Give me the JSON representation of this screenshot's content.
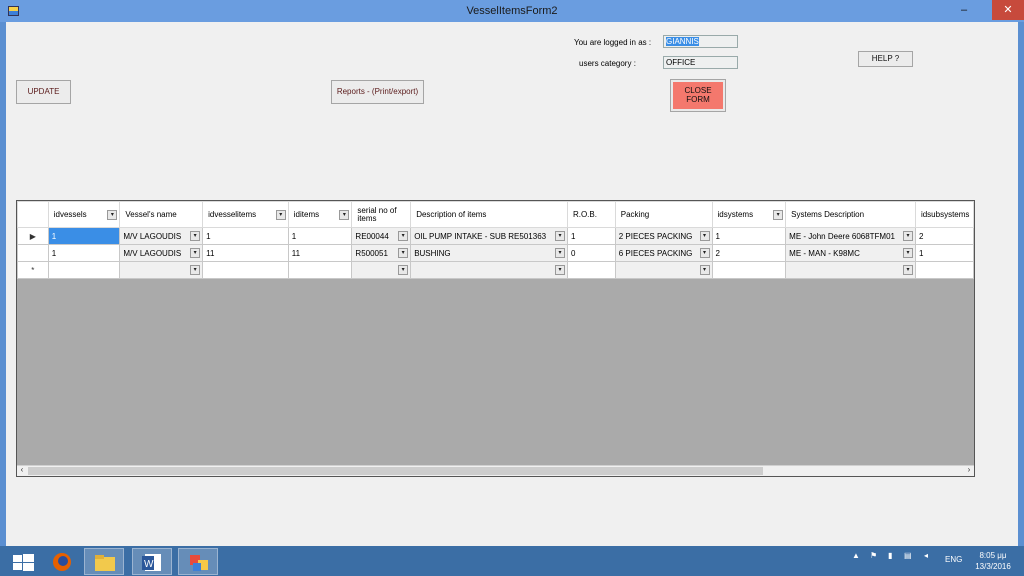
{
  "window": {
    "title": "VesselItemsForm2",
    "min": "–",
    "max": "☐",
    "close": "✕"
  },
  "login": {
    "logged_in_label": "You are logged in as :",
    "user": "GIANNIS",
    "category_label": "users category :",
    "category": "OFFICE"
  },
  "buttons": {
    "update": "UPDATE",
    "reports": "Reports - (Print/export)",
    "close_form_line1": "CLOSE",
    "close_form_line2": "FORM",
    "help": "HELP ?"
  },
  "grid": {
    "columns": [
      "idvessels",
      "Vessel's  name",
      "idvesselitems",
      "iditems",
      "serial no of items",
      "Description of items",
      "R.O.B.",
      "Packing",
      "idsystems",
      "Systems Description",
      "idsubsystems"
    ],
    "rows": [
      [
        "1",
        "M/V LAGOUDIS",
        "1",
        "1",
        "RE00044",
        "OIL PUMP INTAKE - SUB RE501363",
        "1",
        "2 PIECES PACKING",
        "1",
        "ME - John Deere 6068TFM01",
        "2"
      ],
      [
        "1",
        "M/V LAGOUDIS",
        "11",
        "11",
        "R500051",
        "BUSHING",
        "0",
        "6 PIECES PACKING",
        "2",
        "ME - MAN - K98MC",
        "1"
      ]
    ],
    "current_row_marker": "▶",
    "new_row_marker": "*"
  },
  "taskbar": {
    "language": "ENG",
    "time": "8:05 μμ",
    "date": "13/3/2016"
  }
}
